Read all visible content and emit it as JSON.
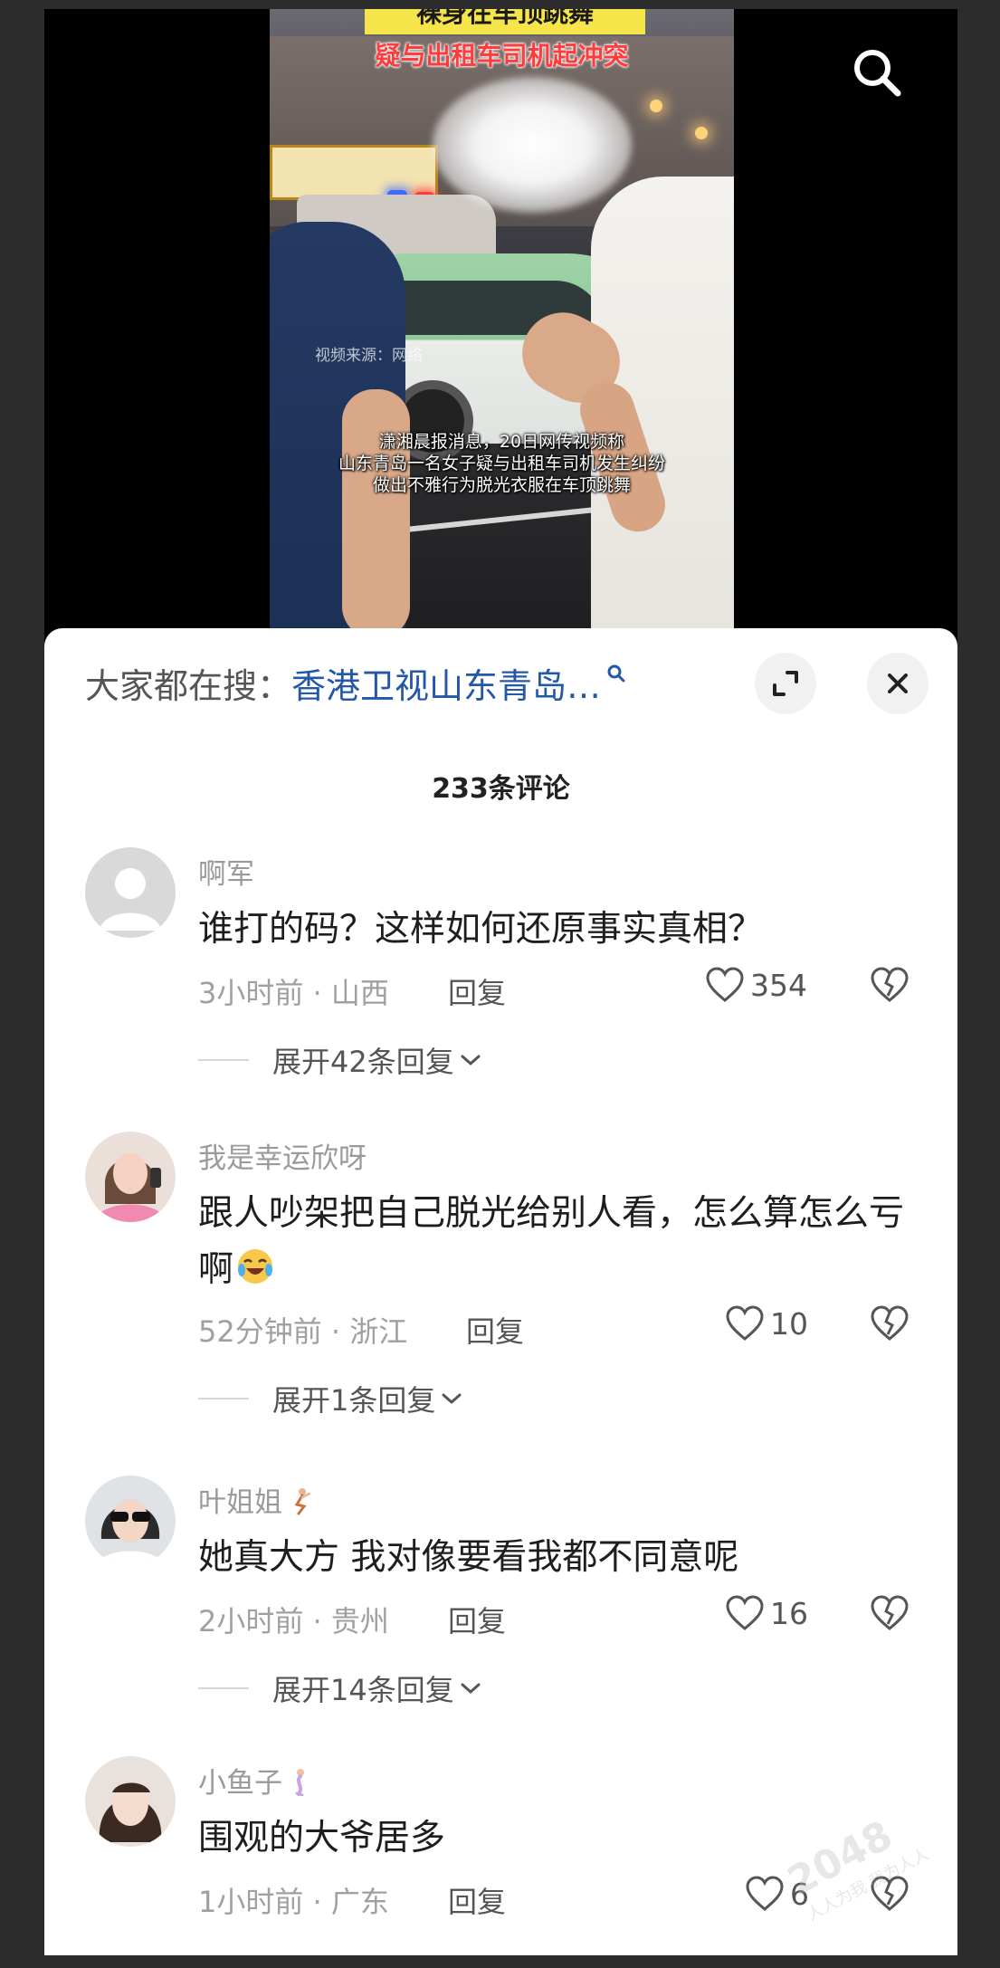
{
  "video": {
    "banner_title": "裸身在车顶跳舞",
    "banner_subtitle": "疑与出租车司机起冲突",
    "watermark": "视频来源：网络",
    "caption_line1": "潇湘晨报消息，20日网传视频称",
    "caption_line2": "山东青岛一名女子疑与出租车司机发生纠纷",
    "caption_line3": "做出不雅行为脱光衣服在车顶跳舞",
    "search_icon": "search-icon"
  },
  "sheet": {
    "search_prefix": "大家都在搜：",
    "search_query": "香港卫视山东青岛…",
    "expand_icon": "expand-icon",
    "close_icon": "close-icon",
    "comment_count": "233条评论"
  },
  "comments": [
    {
      "name": "啊军",
      "text": "谁打的码？这样如何还原事实真相？",
      "time": "3小时前",
      "location": "山西",
      "meta": "3小时前 · 山西",
      "reply": "回复",
      "likes": "354",
      "expand": "展开42条回复"
    },
    {
      "name": "我是幸运欣呀",
      "text": "跟人吵架把自己脱光给别人看，怎么算怎么亏啊",
      "time": "52分钟前",
      "location": "浙江",
      "meta": "52分钟前 · 浙江",
      "reply": "回复",
      "likes": "10",
      "expand": "展开1条回复"
    },
    {
      "name": "叶姐姐",
      "text": "她真大方 我对像要看我都不同意呢",
      "time": "2小时前",
      "location": "贵州",
      "meta": "2小时前 · 贵州",
      "reply": "回复",
      "likes": "16",
      "expand": "展开14条回复"
    },
    {
      "name": "小鱼子",
      "text": "围观的大爷居多",
      "time": "1小时前",
      "location": "广东",
      "meta": "1小时前 · 广东",
      "reply": "回复",
      "likes": "6"
    }
  ],
  "site_watermark": {
    "number": "2048",
    "text": "人人为我 我为人人"
  },
  "colors": {
    "link": "#2357a8",
    "banner_yellow": "#f6e54a",
    "banner_red": "#ff3b3b"
  }
}
